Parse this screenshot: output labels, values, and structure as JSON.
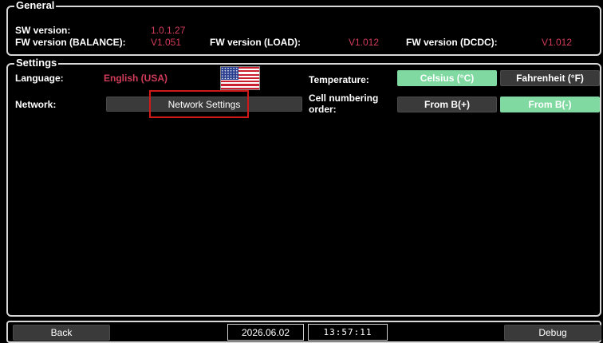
{
  "general": {
    "legend": "General",
    "sw_version_label": "SW version:",
    "sw_version_value": "1.0.1.27",
    "fw_balance_label": "FW version (BALANCE):",
    "fw_balance_value": "V1.051",
    "fw_load_label": "FW version (LOAD):",
    "fw_load_value": "V1.012",
    "fw_dcdc_label": "FW version (DCDC):",
    "fw_dcdc_value": "V1.012"
  },
  "settings": {
    "legend": "Settings",
    "language_label": "Language:",
    "language_value": "English (USA)",
    "temperature_label": "Temperature:",
    "celsius_button": "Celsius (°C)",
    "fahrenheit_button": "Fahrenheit (°F)",
    "network_label": "Network:",
    "network_settings_button": "Network Settings",
    "cell_numbering_label_line1": "Cell numbering",
    "cell_numbering_label_line2": "order:",
    "from_b_plus_button": "From B(+)",
    "from_b_minus_button": "From B(-)",
    "temperature_selected": "Celsius (°C)",
    "cell_numbering_selected": "From B(-)"
  },
  "footer": {
    "back_button": "Back",
    "date": "2026.06.02",
    "time": "13:57:11",
    "debug_button": "Debug"
  },
  "colors": {
    "value_text": "#d13c5a",
    "active_button": "#7fd9a0",
    "highlight_box": "#d01818"
  }
}
